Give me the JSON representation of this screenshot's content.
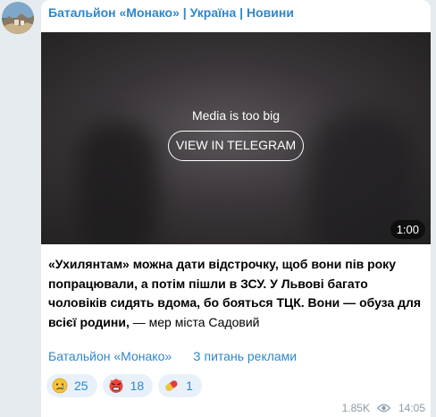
{
  "channel": {
    "title": "Батальйон «Монако» | Україна | Новини",
    "avatar_icon": "avatar"
  },
  "media": {
    "note": "Media is too big",
    "view_button": "VIEW IN TELEGRAM",
    "duration": "1:00"
  },
  "post": {
    "text_bold": "«Ухилянтам» можна дати відстрочку, щоб вони пів року попрацювали, а потім пішли в ЗСУ. У Львові багато чоловіків сидять вдома, бо бояться ТЦК. Вони — обуза для всієї родини,",
    "text_regular": " — мер міста Садовий"
  },
  "links": {
    "channel_link": "Батальйон «Монако»",
    "ads_link": "З питань реклами"
  },
  "reactions": [
    {
      "icon": "sad-face-icon",
      "count": "25"
    },
    {
      "icon": "angry-face-icon",
      "count": "18"
    },
    {
      "icon": "pill-icon",
      "count": "1"
    }
  ],
  "footer": {
    "views": "1.85K",
    "time": "14:05",
    "views_icon": "eye-icon"
  },
  "colors": {
    "accent": "#2f86c9",
    "reaction_bg": "#e8f1fa",
    "page_bg": "#e5ebee"
  }
}
